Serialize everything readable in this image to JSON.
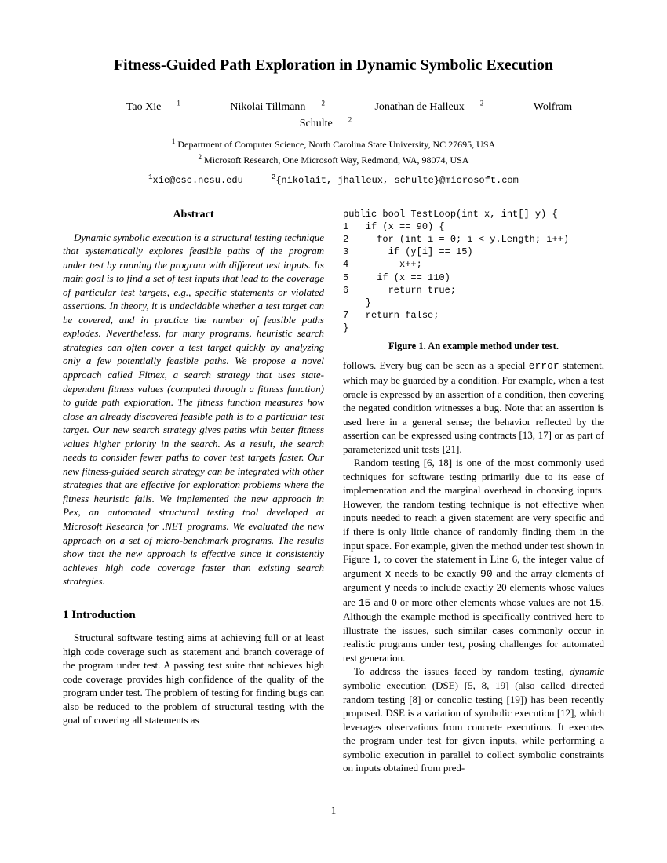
{
  "title": "Fitness-Guided Path Exploration in Dynamic Symbolic Execution",
  "authors": {
    "a1": "Tao Xie",
    "a2": "Nikolai Tillmann",
    "a3": "Jonathan de Halleux",
    "a4": "Wolfram Schulte"
  },
  "affiliations": {
    "aff1": "Department of Computer Science, North Carolina State University, NC 27695, USA",
    "aff2": "Microsoft Research, One Microsoft Way, Redmond, WA, 98074, USA"
  },
  "emails": {
    "e1": "xie@csc.ncsu.edu",
    "e2": "{nikolait, jhalleux, schulte}@microsoft.com"
  },
  "abstract_heading": "Abstract",
  "abstract_body": "Dynamic symbolic execution is a structural testing technique that systematically explores feasible paths of the program under test by running the program with different test inputs. Its main goal is to find a set of test inputs that lead to the coverage of particular test targets, e.g., specific statements or violated assertions. In theory, it is undecidable whether a test target can be covered, and in practice the number of feasible paths explodes. Nevertheless, for many programs, heuristic search strategies can often cover a test target quickly by analyzing only a few potentially feasible paths. We propose a novel approach called Fitnex, a search strategy that uses state-dependent fitness values (computed through a fitness function) to guide path exploration. The fitness function measures how close an already discovered feasible path is to a particular test target. Our new search strategy gives paths with better fitness values higher priority in the search. As a result, the search needs to consider fewer paths to cover test targets faster. Our new fitness-guided search strategy can be integrated with other strategies that are effective for exploration problems where the fitness heuristic fails. We implemented the new approach in Pex, an automated structural testing tool developed at Microsoft Research for .NET programs. We evaluated the new approach on a set of micro-benchmark programs. The results show that the new approach is effective since it consistently achieves high code coverage faster than existing search strategies.",
  "section1_heading": "1   Introduction",
  "section1_p1": "Structural software testing aims at achieving full or at least high code coverage such as statement and branch coverage of the program under test. A passing test suite that achieves high code coverage provides high confidence of the quality of the program under test. The problem of testing for finding bugs can also be reduced to the problem of structural testing with the goal of covering all statements as",
  "code": "public bool TestLoop(int x, int[] y) {\n1   if (x == 90) {\n2     for (int i = 0; i < y.Length; i++)\n3       if (y[i] == 15)\n4         x++;\n5     if (x == 110)\n6       return true;\n    }\n7   return false;\n}",
  "fig1_caption": "Figure 1. An example method under test.",
  "col2_p1a": "follows. Every bug can be seen as a special ",
  "col2_p1_error": "error",
  "col2_p1b": " statement, which may be guarded by a condition. For example, when a test oracle is expressed by an assertion of a condition, then covering the negated condition witnesses a bug. Note that an assertion is used here in a general sense; the behavior reflected by the assertion can be expressed using contracts [13, 17] or as part of parameterized unit tests [21].",
  "col2_p2a": "Random testing [6, 18] is one of the most commonly used techniques for software testing primarily due to its ease of implementation and the marginal overhead in choosing inputs. However, the random testing technique is not effective when inputs needed to reach a given statement are very specific and if there is only little chance of randomly finding them in the input space. For example, given the method under test shown in Figure 1, to cover the statement in Line 6, the integer value of argument ",
  "col2_p2_x": "x",
  "col2_p2b": " needs to be exactly ",
  "col2_p2_90": "90",
  "col2_p2c": " and the array elements of argument ",
  "col2_p2_y": "y",
  "col2_p2d": " needs to include exactly 20 elements whose values are ",
  "col2_p2_15": "15",
  "col2_p2e": " and 0 or more other elements whose values are not ",
  "col2_p2_15b": "15",
  "col2_p2f": ". Although the example method is specifically contrived here to illustrate the issues, such similar cases commonly occur in realistic programs under test, posing challenges for automated test generation.",
  "col2_p3a": "To address the issues faced by random testing, ",
  "col2_p3_dyn": "dynamic",
  "col2_p3b": " symbolic execution (DSE) [5, 8, 19] (also called directed random testing [8] or concolic testing [19]) has been recently proposed. DSE is a variation of symbolic execution [12], which leverages observations from concrete executions. It executes the program under test for given inputs, while performing a symbolic execution in parallel to collect symbolic constraints on inputs obtained from pred-",
  "page_number": "1"
}
